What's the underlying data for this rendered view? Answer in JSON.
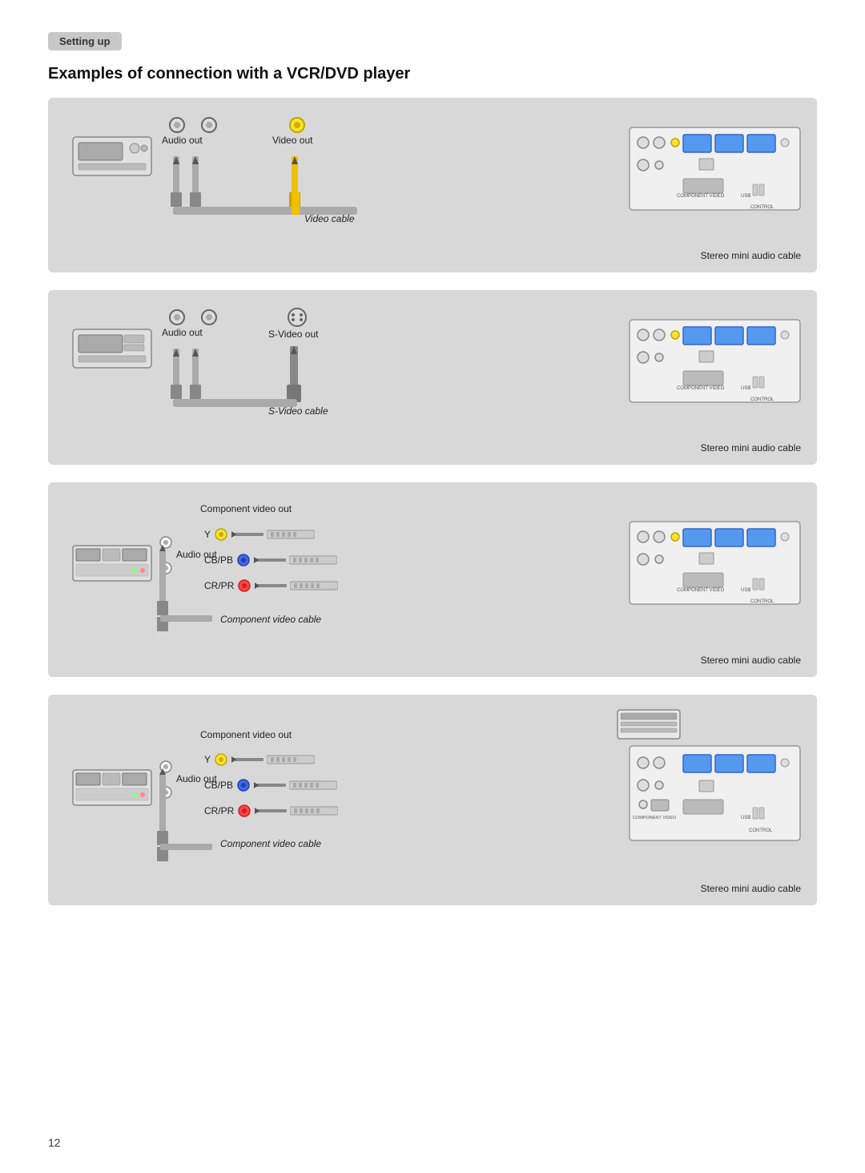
{
  "section": {
    "header": "Setting up",
    "title": "Examples of connection with a VCR/DVD player",
    "page_number": "12"
  },
  "diagrams": [
    {
      "id": "vcr-composite",
      "labels": {
        "audio_out": "Audio out",
        "video_out": "Video out",
        "cable1": "Video cable",
        "cable2": "Stereo mini audio cable"
      }
    },
    {
      "id": "vcr-svideo",
      "labels": {
        "audio_out": "Audio out",
        "video_out": "S-Video out",
        "cable1": "S-Video cable",
        "cable2": "Stereo mini audio cable"
      }
    },
    {
      "id": "dvd-component1",
      "labels": {
        "component_out": "Component video out",
        "audio_out": "Audio out",
        "y": "Y",
        "cb_pb": "CB/PB",
        "cr_pr": "CR/PR",
        "cable1": "Component video cable",
        "cable2": "Stereo mini audio cable"
      }
    },
    {
      "id": "dvd-component2",
      "labels": {
        "component_out": "Component video out",
        "audio_out": "Audio out",
        "y": "Y",
        "cb_pb": "CB/PB",
        "cr_pr": "CR/PR",
        "cable1": "Component video cable",
        "cable2": "Stereo mini audio cable"
      }
    }
  ]
}
